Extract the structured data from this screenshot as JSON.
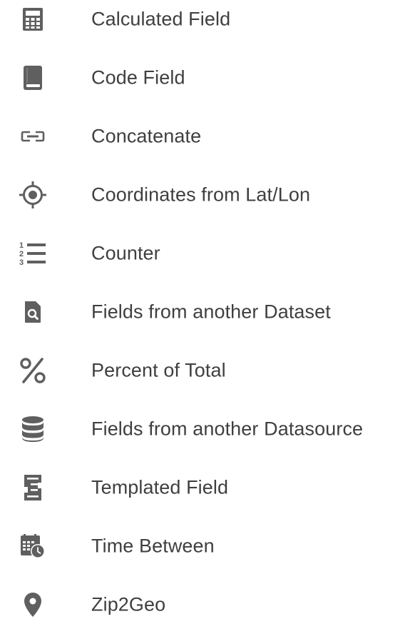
{
  "menu": {
    "items": [
      {
        "label": "Calculated Field",
        "icon": "calculator-icon"
      },
      {
        "label": "Code Field",
        "icon": "book-icon"
      },
      {
        "label": "Concatenate",
        "icon": "link-icon"
      },
      {
        "label": "Coordinates from Lat/Lon",
        "icon": "crosshair-icon"
      },
      {
        "label": "Counter",
        "icon": "numbered-list-icon"
      },
      {
        "label": "Fields from another Dataset",
        "icon": "file-search-icon"
      },
      {
        "label": "Percent of Total",
        "icon": "percent-icon"
      },
      {
        "label": "Fields from another Datasource",
        "icon": "database-icon"
      },
      {
        "label": "Templated Field",
        "icon": "template-icon"
      },
      {
        "label": "Time Between",
        "icon": "calendar-clock-icon"
      },
      {
        "label": "Zip2Geo",
        "icon": "map-pin-icon"
      }
    ]
  },
  "colors": {
    "icon": "#5f5f5f",
    "text": "#3f3f3f",
    "background": "#ffffff"
  }
}
